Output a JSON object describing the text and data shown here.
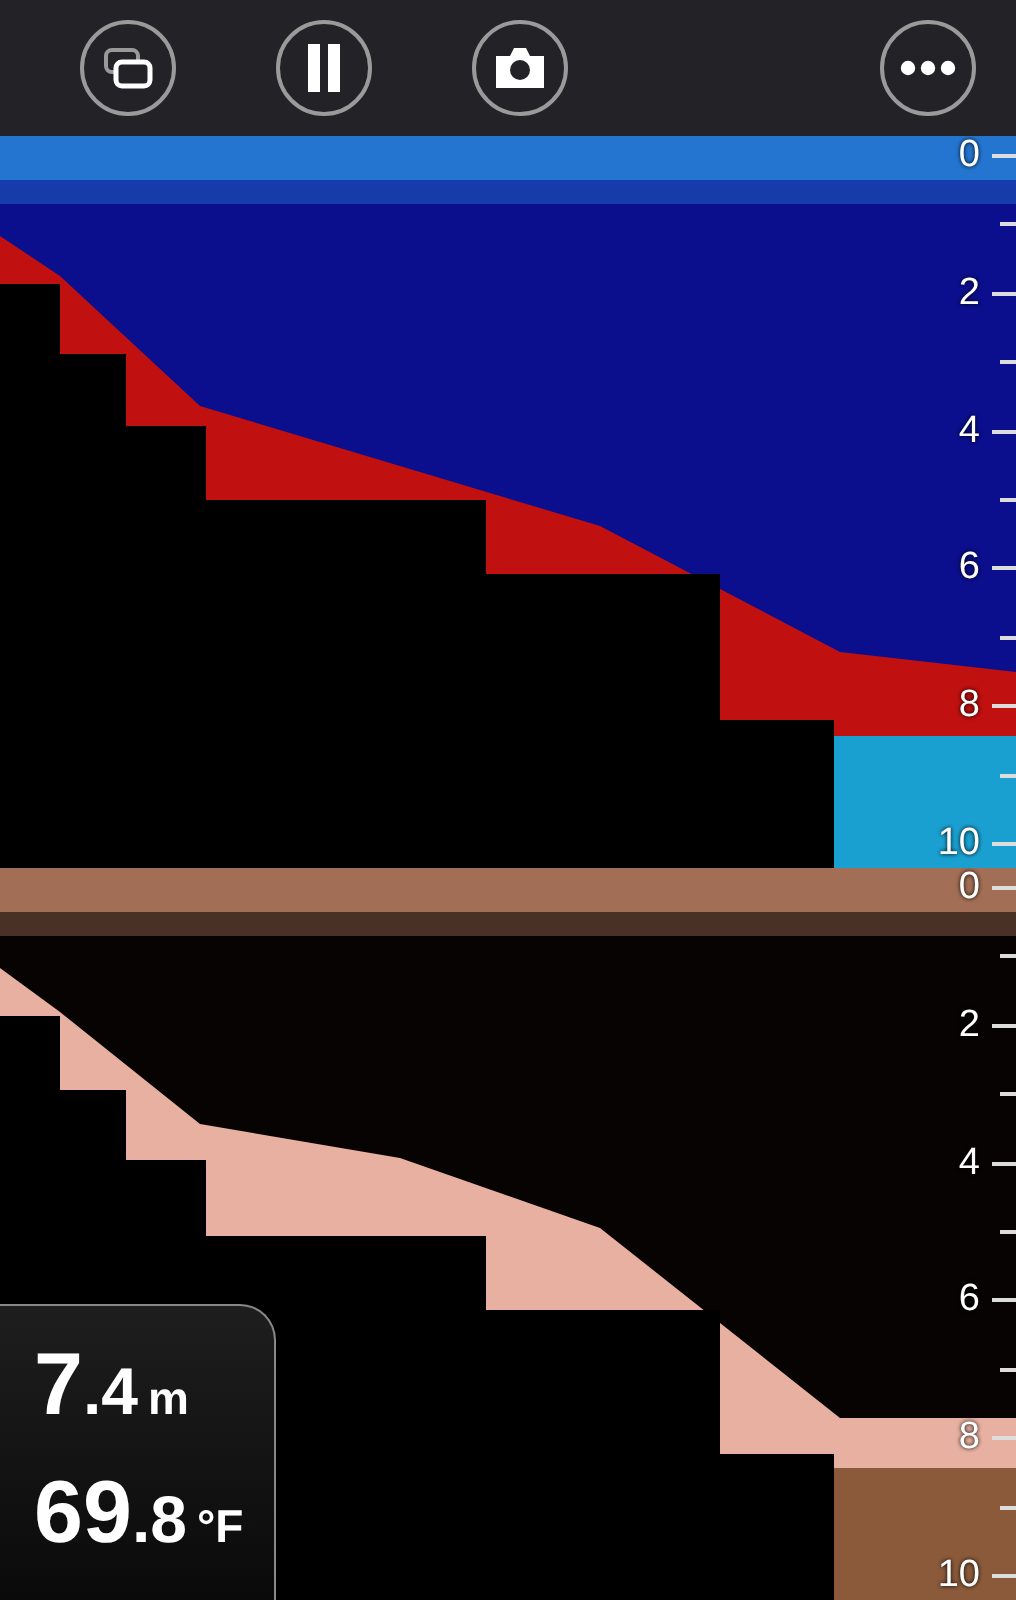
{
  "toolbar": {
    "buttons": [
      {
        "kind": "layers"
      },
      {
        "kind": "pause"
      },
      {
        "kind": "camera"
      },
      {
        "kind": "more"
      }
    ]
  },
  "panels": [
    {
      "kind": "chirp",
      "scale": [
        "0",
        "2",
        "4",
        "6",
        "8",
        "10"
      ]
    },
    {
      "kind": "downscan",
      "scale": [
        "0",
        "2",
        "4",
        "6",
        "8",
        "10"
      ]
    }
  ],
  "readout": [
    {
      "whole": "7",
      "fraction": ".4",
      "unit": "m"
    },
    {
      "whole": "69",
      "fraction": ".8",
      "unit": "°F"
    }
  ]
}
